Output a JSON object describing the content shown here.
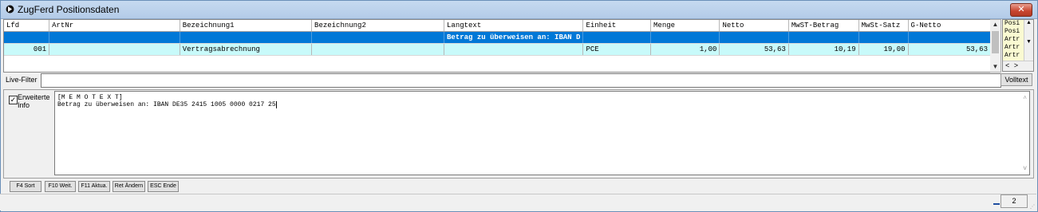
{
  "window": {
    "title": "ZugFerd Positionsdaten",
    "close_label": "✕"
  },
  "grid": {
    "columns": [
      "Lfd",
      "ArtNr",
      "Bezeichnung1",
      "Bezeichnung2",
      "Langtext",
      "Einheit",
      "Menge",
      "Netto",
      "MwST-Betrag",
      "MwSt-Satz",
      "G-Netto"
    ],
    "selected_row": [
      "",
      "",
      "",
      "",
      "Betrag zu überweisen an: IBAN D",
      "",
      "",
      "",
      "",
      "",
      ""
    ],
    "rows": [
      [
        "001",
        "",
        "Vertragsabrechnung",
        "",
        "",
        "PCE",
        "1,00",
        "53,63",
        "10,19",
        "19,00",
        "53,63"
      ]
    ],
    "highlight_color": "#0078d7",
    "data_row_color": "#c8fafa"
  },
  "side_list": {
    "items": [
      "Posi",
      "Posi",
      "Artr",
      "Artr",
      "Artr"
    ],
    "hscroll_label": "< >"
  },
  "filter": {
    "label": "Live-Filter",
    "value": "",
    "button_label": "Volltext"
  },
  "memo": {
    "checkbox_label_1": "Erweiterte",
    "checkbox_label_2": "Info",
    "checked": true,
    "line1": "[M E M O T E X T]",
    "line2": "Betrag zu überweisen an: IBAN DE35 2415 1005 0000 0217 25"
  },
  "function_keys": [
    "F4 Sort",
    "F10 Weit.",
    "F11 Aktua.",
    "Ret Ändern",
    "ESC Ende"
  ],
  "status": {
    "count": "2"
  }
}
